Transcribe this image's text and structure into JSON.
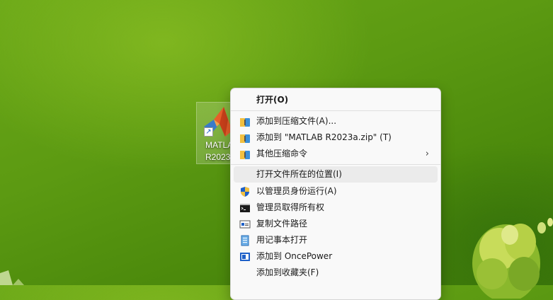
{
  "desktop": {
    "icon_label_line1": "MATLAB",
    "icon_label_line2": "R2023a",
    "shortcut_glyph": "↗"
  },
  "menu": {
    "items": [
      {
        "label": "打开(O)",
        "icon": "none"
      },
      {
        "label": "添加到压缩文件(A)...",
        "icon": "archive-icon"
      },
      {
        "label": "添加到 \"MATLAB R2023a.zip\" (T)",
        "icon": "archive-icon"
      },
      {
        "label": "其他压缩命令",
        "icon": "archive-icon",
        "arrow": "›"
      },
      {
        "label": "打开文件所在的位置(I)",
        "icon": "none"
      },
      {
        "label": "以管理员身份运行(A)",
        "icon": "uac-shield-icon"
      },
      {
        "label": "管理员取得所有权",
        "icon": "cmd-icon"
      },
      {
        "label": "复制文件路径",
        "icon": "path-copy-icon"
      },
      {
        "label": "用记事本打开",
        "icon": "notepad-icon"
      },
      {
        "label": "添加到 OncePower",
        "icon": "oncepower-icon"
      },
      {
        "label": "添加到收藏夹(F)",
        "icon": "none"
      }
    ]
  },
  "colors": {
    "accent_blue": "#1e60c8",
    "menu_bg": "#f9f9f9",
    "highlight": "#ebebeb"
  }
}
